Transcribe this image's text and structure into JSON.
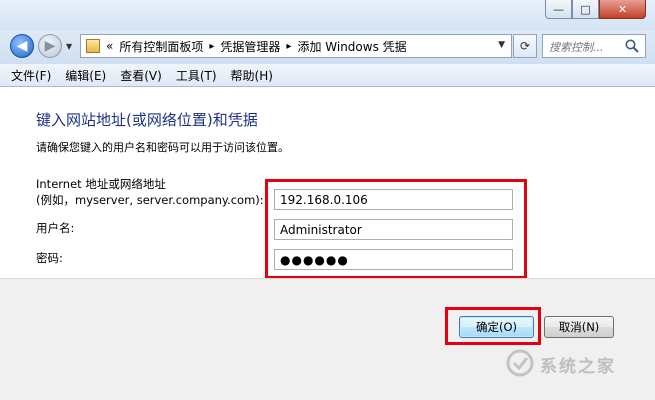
{
  "window": {
    "controls": {
      "minimize": "—",
      "maximize": "□",
      "close": "✕"
    }
  },
  "nav": {
    "back_icon": "back-arrow-icon",
    "forward_icon": "forward-arrow-icon",
    "breadcrumb_prefix": "«",
    "breadcrumbs": [
      "所有控制面板项",
      "凭据管理器",
      "添加 Windows 凭据"
    ],
    "separator": "▸",
    "search_placeholder": "搜索控制..."
  },
  "menu": {
    "items": [
      "文件(F)",
      "编辑(E)",
      "查看(V)",
      "工具(T)",
      "帮助(H)"
    ]
  },
  "main": {
    "heading": "键入网站地址(或网络位置)和凭据",
    "subtext": "请确保您键入的用户名和密码可以用于访问该位置。",
    "address_label_line1": "Internet 地址或网络地址",
    "address_label_line2": "(例如，myserver, server.company.com):",
    "address_value": "192.168.0.106",
    "username_label": "用户名:",
    "username_value": "Administrator",
    "password_label": "密码:",
    "password_value": "●●●●●●"
  },
  "buttons": {
    "ok": "确定(O)",
    "cancel": "取消(N)"
  },
  "watermark": "系统之家",
  "colors": {
    "heading": "#1e3287",
    "highlight": "#e3000f"
  }
}
